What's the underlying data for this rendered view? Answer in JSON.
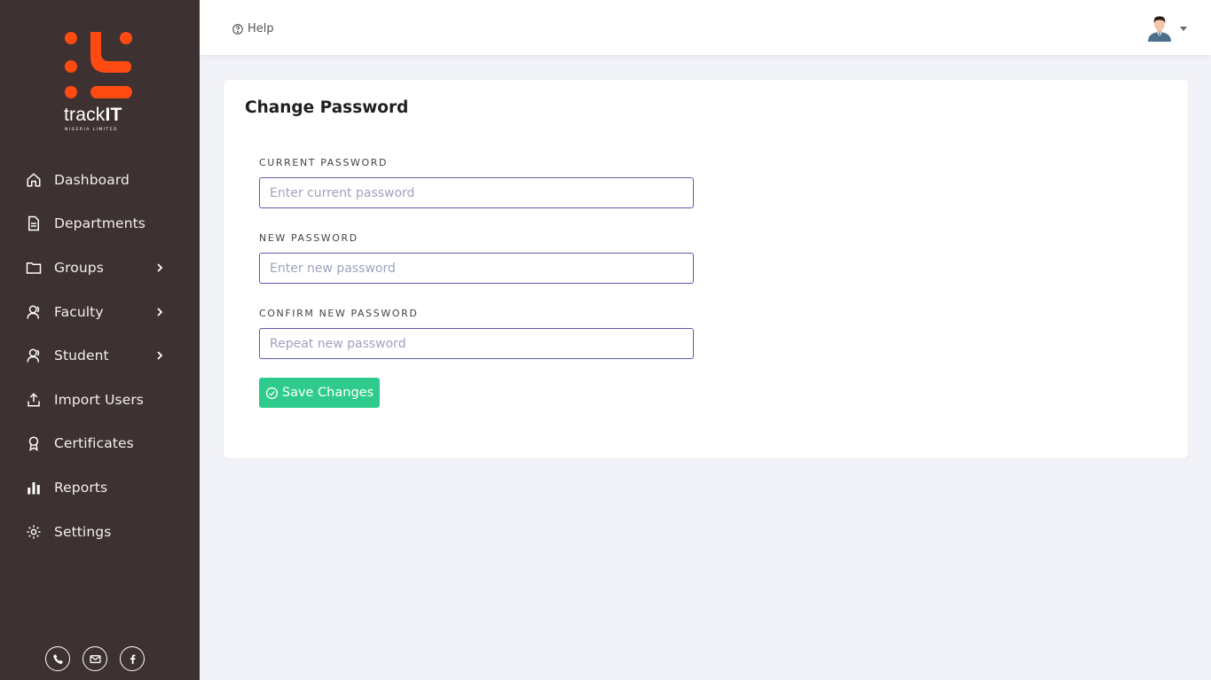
{
  "brand": {
    "name_light": "track",
    "name_bold": "IT",
    "tagline": "NIGERIA LIMITED",
    "logo_color": "#ff4a12"
  },
  "sidebar": {
    "items": [
      {
        "label": "Dashboard",
        "icon": "home-icon",
        "has_submenu": false
      },
      {
        "label": "Departments",
        "icon": "document-icon",
        "has_submenu": false
      },
      {
        "label": "Groups",
        "icon": "folder-icon",
        "has_submenu": true
      },
      {
        "label": "Faculty",
        "icon": "user-icon",
        "has_submenu": true
      },
      {
        "label": "Student",
        "icon": "user-icon",
        "has_submenu": true
      },
      {
        "label": "Import Users",
        "icon": "upload-icon",
        "has_submenu": false
      },
      {
        "label": "Certificates",
        "icon": "award-icon",
        "has_submenu": false
      },
      {
        "label": "Reports",
        "icon": "bar-chart-icon",
        "has_submenu": false
      },
      {
        "label": "Settings",
        "icon": "gear-icon",
        "has_submenu": false
      }
    ],
    "social": [
      "phone-icon",
      "mail-icon",
      "facebook-icon"
    ]
  },
  "topbar": {
    "help_label": "Help"
  },
  "form": {
    "title": "Change Password",
    "current": {
      "label": "CURRENT PASSWORD",
      "placeholder": "Enter current password",
      "value": ""
    },
    "new": {
      "label": "NEW PASSWORD",
      "placeholder": "Enter new password",
      "value": ""
    },
    "confirm": {
      "label": "CONFIRM NEW PASSWORD",
      "placeholder": "Repeat new password",
      "value": ""
    },
    "save_label": "Save Changes"
  },
  "colors": {
    "sidebar_bg": "#3d3131",
    "accent": "#ff4a12",
    "save_button": "#2ecb8c",
    "input_border": "#5b5bb3",
    "page_bg": "#f2f3f8"
  }
}
